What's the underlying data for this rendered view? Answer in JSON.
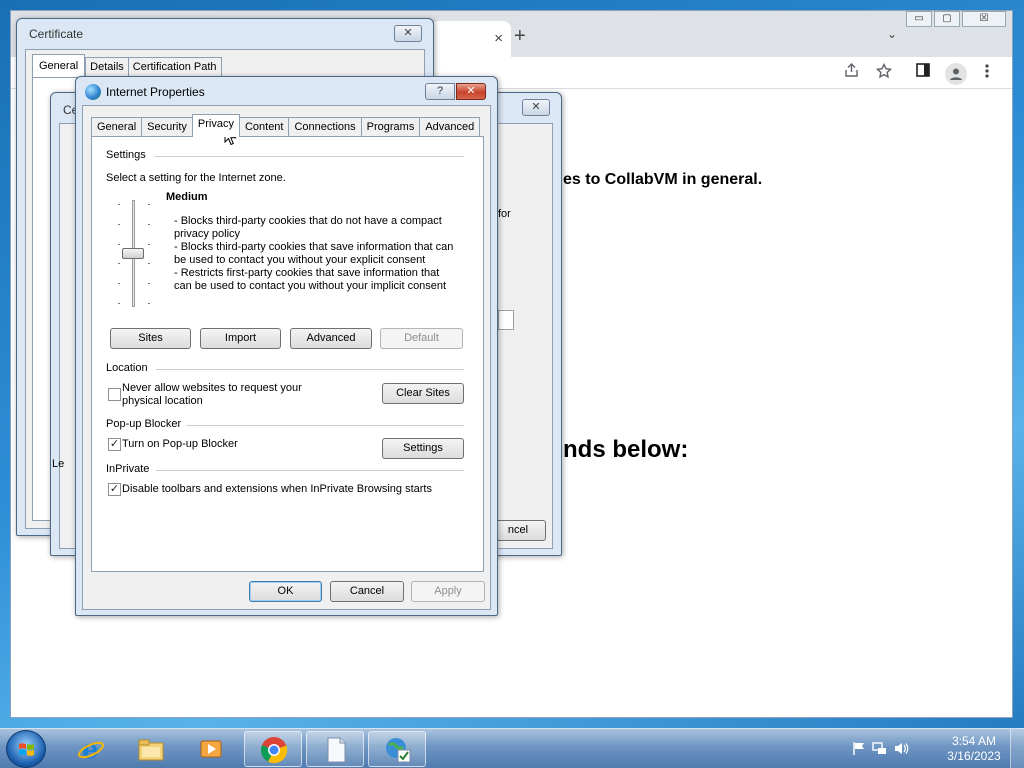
{
  "browser": {
    "tab_close": "×",
    "new_tab": "+",
    "tab_search": "⌄",
    "min_label": "▭",
    "max_label": "▢",
    "close_label": "☒",
    "page_text_1": "es to CollabVM in general.",
    "page_text_2": "nds below:",
    "snippet_for": "for",
    "snippet_cancel": "ncel"
  },
  "certificate": {
    "title": "Certificate",
    "tabs": [
      "General",
      "Details",
      "Certification Path"
    ],
    "inner_title": "Ce",
    "side_letter": "Le"
  },
  "internet_properties": {
    "title": "Internet Properties",
    "help": "?",
    "close": "✕",
    "tabs": [
      {
        "label": "General",
        "active": false
      },
      {
        "label": "Security",
        "active": false
      },
      {
        "label": "Privacy",
        "active": true
      },
      {
        "label": "Content",
        "active": false
      },
      {
        "label": "Connections",
        "active": false
      },
      {
        "label": "Programs",
        "active": false
      },
      {
        "label": "Advanced",
        "active": false
      }
    ],
    "settings_group": "Settings",
    "zone_prompt": "Select a setting for the Internet zone.",
    "level": "Medium",
    "level_value": 0.5,
    "description": [
      "- Blocks third-party cookies that do not have a compact",
      "privacy policy",
      "- Blocks third-party cookies that save information that can",
      "be used to contact you without your explicit consent",
      "- Restricts first-party cookies that save information that",
      "can be used to contact you without your implicit consent"
    ],
    "buttons": {
      "sites": "Sites",
      "import": "Import",
      "advanced": "Advanced",
      "default": "Default",
      "clear_sites": "Clear Sites",
      "popup_settings": "Settings",
      "ok": "OK",
      "cancel": "Cancel",
      "apply": "Apply"
    },
    "location_group": "Location",
    "location_option_line1": "Never allow websites to request your",
    "location_option_line2": "physical location",
    "location_checked": false,
    "popup_group": "Pop-up Blocker",
    "popup_option": "Turn on Pop-up Blocker",
    "popup_checked": true,
    "inprivate_group": "InPrivate",
    "inprivate_option": "Disable toolbars and extensions when InPrivate Browsing starts",
    "inprivate_checked": true,
    "check_mark": "✓"
  },
  "taskbar": {
    "time": "3:54 AM",
    "date": "3/16/2023",
    "items": [
      "internet-explorer",
      "file-explorer",
      "media-player",
      "chrome",
      "notepad",
      "internet-properties"
    ]
  },
  "colors": {
    "accent": "#3c7fb1",
    "close_red": "#c8432b"
  }
}
